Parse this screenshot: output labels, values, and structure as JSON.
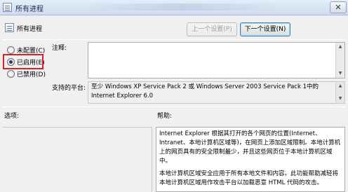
{
  "window": {
    "title": "所有进程",
    "close_glyph": "✕"
  },
  "header": {
    "setting_name": "所有进程"
  },
  "navigation": {
    "prev_label": "上一个设置(P)",
    "next_label": "下一个设置(N)"
  },
  "state_options": [
    {
      "label": "未配置(C)",
      "checked": false
    },
    {
      "label": "已启用(E)",
      "checked": true
    },
    {
      "label": "已禁用(D)",
      "checked": false
    }
  ],
  "comment": {
    "label": "注释:",
    "value": ""
  },
  "platform": {
    "label": "支持的平台:",
    "line1": "至少 Windows XP Service Pack 2 或 Windows Server 2003 Service Pack 1中的",
    "line2": "Internet Explorer 6.0"
  },
  "options_section": {
    "label": "选项:"
  },
  "help_section": {
    "label": "帮助:",
    "paragraph1": "Internet Explorer 根据其打开的各个网页的位置(Internet、Intranet、本地计算机区域等)，在网页上添加区域限制。本地计算机上的网页具有的安全限制最少，并且这些网页位于本地计算机区域中。",
    "paragraph2": "本地计算机区域安全应用于所有本地文件和内容。此功能帮助减轻将本地计算机区域用作攻击平台以加载恶意 HTML 代码的攻击。"
  },
  "colors": {
    "highlight_border": "#d6202a",
    "radio_dot": "#1e3f7a"
  }
}
